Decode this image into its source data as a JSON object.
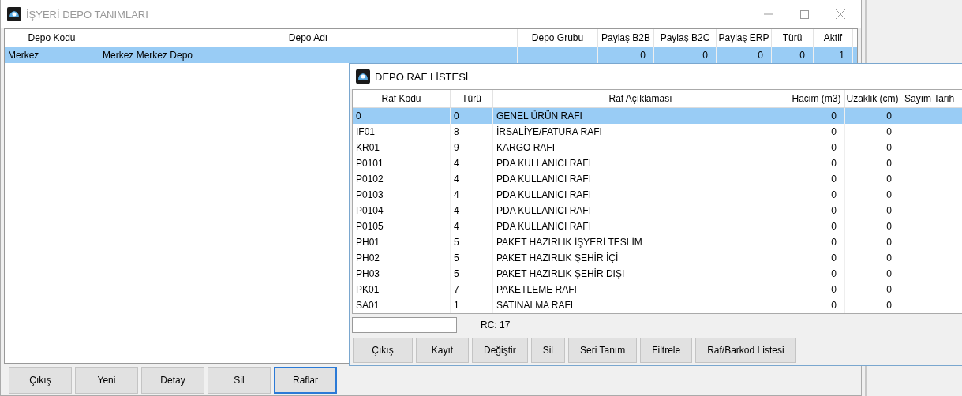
{
  "main_window": {
    "title": "İŞYERİ DEPO TANIMLARI",
    "table": {
      "columns": [
        "Depo Kodu",
        "Depo Adı",
        "Depo Grubu",
        "Paylaş B2B",
        "Paylaş B2C",
        "Paylaş ERP",
        "Türü",
        "Aktif"
      ],
      "rows": [
        {
          "selected": true,
          "cells": [
            "Merkez",
            "Merkez Merkez Depo",
            "",
            "0",
            "0",
            "0",
            "0",
            "1"
          ]
        }
      ]
    },
    "buttons": [
      {
        "label": "Çıkış",
        "selected": false
      },
      {
        "label": "Yeni",
        "selected": false
      },
      {
        "label": "Detay",
        "selected": false
      },
      {
        "label": "Sil",
        "selected": false
      },
      {
        "label": "Raflar",
        "selected": true
      }
    ]
  },
  "dialog": {
    "title": "DEPO RAF LİSTESİ",
    "table": {
      "columns": [
        "Raf Kodu",
        "Türü",
        "Raf Açıklaması",
        "Hacim (m3)",
        "Uzaklik (cm)",
        "Sayım Tarih"
      ],
      "rows": [
        {
          "selected": true,
          "cells": [
            "0",
            "0",
            "GENEL ÜRÜN RAFI",
            "0",
            "0",
            ""
          ]
        },
        {
          "selected": false,
          "cells": [
            "IF01",
            "8",
            "İRSALİYE/FATURA RAFI",
            "0",
            "0",
            ""
          ]
        },
        {
          "selected": false,
          "cells": [
            "KR01",
            "9",
            "KARGO RAFI",
            "0",
            "0",
            ""
          ]
        },
        {
          "selected": false,
          "cells": [
            "P0101",
            "4",
            "PDA KULLANICI RAFI",
            "0",
            "0",
            ""
          ]
        },
        {
          "selected": false,
          "cells": [
            "P0102",
            "4",
            "PDA KULLANICI RAFI",
            "0",
            "0",
            ""
          ]
        },
        {
          "selected": false,
          "cells": [
            "P0103",
            "4",
            "PDA KULLANICI RAFI",
            "0",
            "0",
            ""
          ]
        },
        {
          "selected": false,
          "cells": [
            "P0104",
            "4",
            "PDA KULLANICI RAFI",
            "0",
            "0",
            ""
          ]
        },
        {
          "selected": false,
          "cells": [
            "P0105",
            "4",
            "PDA KULLANICI RAFI",
            "0",
            "0",
            ""
          ]
        },
        {
          "selected": false,
          "cells": [
            "PH01",
            "5",
            "PAKET HAZIRLIK İŞYERİ TESLİM",
            "0",
            "0",
            ""
          ]
        },
        {
          "selected": false,
          "cells": [
            "PH02",
            "5",
            "PAKET HAZIRLIK ŞEHİR İÇİ",
            "0",
            "0",
            ""
          ]
        },
        {
          "selected": false,
          "cells": [
            "PH03",
            "5",
            "PAKET HAZIRLIK ŞEHİR DIŞI",
            "0",
            "0",
            ""
          ]
        },
        {
          "selected": false,
          "cells": [
            "PK01",
            "7",
            "PAKETLEME RAFI",
            "0",
            "0",
            ""
          ]
        },
        {
          "selected": false,
          "cells": [
            "SA01",
            "1",
            "SATINALMA RAFI",
            "0",
            "0",
            ""
          ]
        }
      ]
    },
    "record_count": "RC: 17",
    "buttons": [
      "Çıkış",
      "Kayıt",
      "Değiştir",
      "Sil",
      "Seri Tanım",
      "Filtrele",
      "Raf/Barkod Listesi"
    ]
  }
}
